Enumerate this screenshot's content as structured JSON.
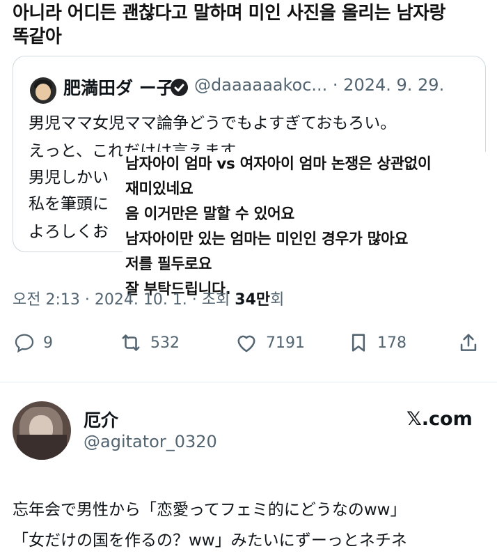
{
  "caption": {
    "line1": "아니라 어디든 괜찮다고 말하며 미인 사진을 올리는 남자랑",
    "line2": "똑같아"
  },
  "quoted_tweet": {
    "display_name": "肥満田ダ ー子",
    "handle_and_date": "@daaaaaakoc... · 2024. 9. 29.",
    "lines": [
      "男児ママ女児ママ論争どうでもよすぎておもろい。",
      "えっと、これだけは言えます。",
      "男児しかい",
      "私を筆頭に",
      "よろしくお"
    ]
  },
  "translation_overlay": {
    "lines": [
      "남자아이 엄마 vs 여자아이 엄마 논쟁은 상관없이",
      "재미있네요",
      "음 이거만은 말할 수 있어요",
      "남자아이만 있는 엄마는 미인인 경우가 많아요",
      "저를 필두로요",
      "잘 부탁드립니다."
    ]
  },
  "tweet_meta": {
    "time_date": "오전 2:13 · 2024. 10. 1. · 조회 ",
    "views_bold": "34만",
    "views_suffix": "회"
  },
  "actions": {
    "replies": "9",
    "retweets": "532",
    "likes": "7191",
    "bookmarks": "178"
  },
  "second_tweet": {
    "display_name": "厄介",
    "handle": "@agitator_0320",
    "source": "𝕏.com",
    "text_line1": "忘年会で男性から「恋愛ってフェミ的にどうなのww」",
    "text_line2": "「女だけの国を作るの？ww」みたいにずーっとネチネ"
  },
  "colors": {
    "text_primary": "#0f1419",
    "text_secondary": "#536471",
    "border": "#cfd9de"
  },
  "icons": {
    "reply": "speech-bubble-icon",
    "retweet": "retweet-arrows-icon",
    "like": "heart-outline-icon",
    "bookmark": "bookmark-icon",
    "share": "share-upload-icon",
    "verified": "verified-badge-icon"
  }
}
